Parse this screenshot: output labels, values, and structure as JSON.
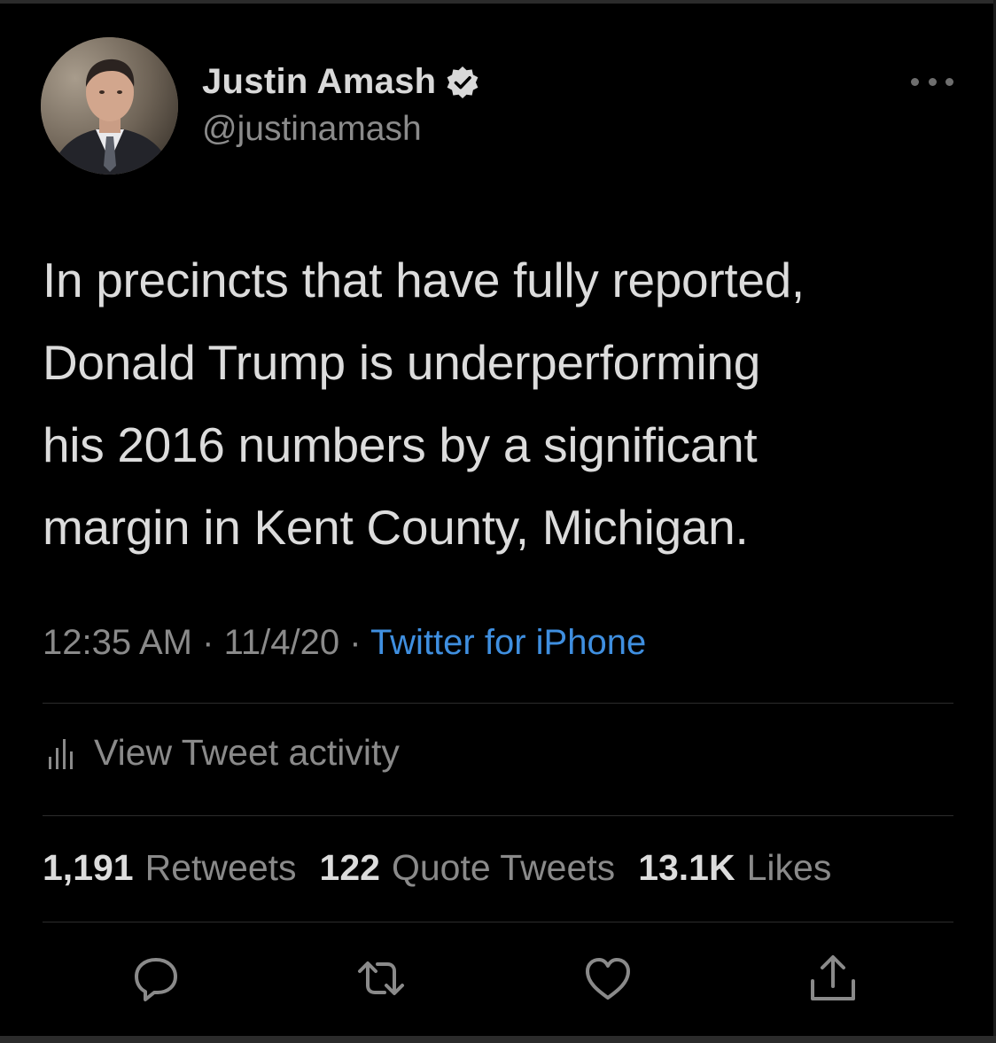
{
  "profile": {
    "display_name": "Justin Amash",
    "handle": "@justinamash",
    "verified_icon": "verified-badge-icon",
    "avatar_icon": "avatar-photo"
  },
  "tweet": {
    "lines": [
      "In precincts that have fully reported,",
      "Donald Trump is underperforming",
      "his 2016 numbers by a significant",
      "margin in Kent County, Michigan."
    ],
    "time": "12:35 AM",
    "separator": "·",
    "date": "11/4/20",
    "source": "Twitter for iPhone"
  },
  "activity": {
    "label": "View Tweet activity",
    "icon": "activity-bars-icon"
  },
  "stats": {
    "retweets_count": "1,191",
    "retweets_label": "Retweets",
    "quotes_count": "122",
    "quotes_label": "Quote Tweets",
    "likes_count": "13.1K",
    "likes_label": "Likes"
  },
  "actions": [
    "reply-icon",
    "retweet-icon",
    "like-icon",
    "share-icon"
  ],
  "colors": {
    "background": "#000000",
    "text": "#d9d9d9",
    "muted": "#8a8a8a",
    "link": "#3f8fe0",
    "divider": "#2c2c2c"
  }
}
